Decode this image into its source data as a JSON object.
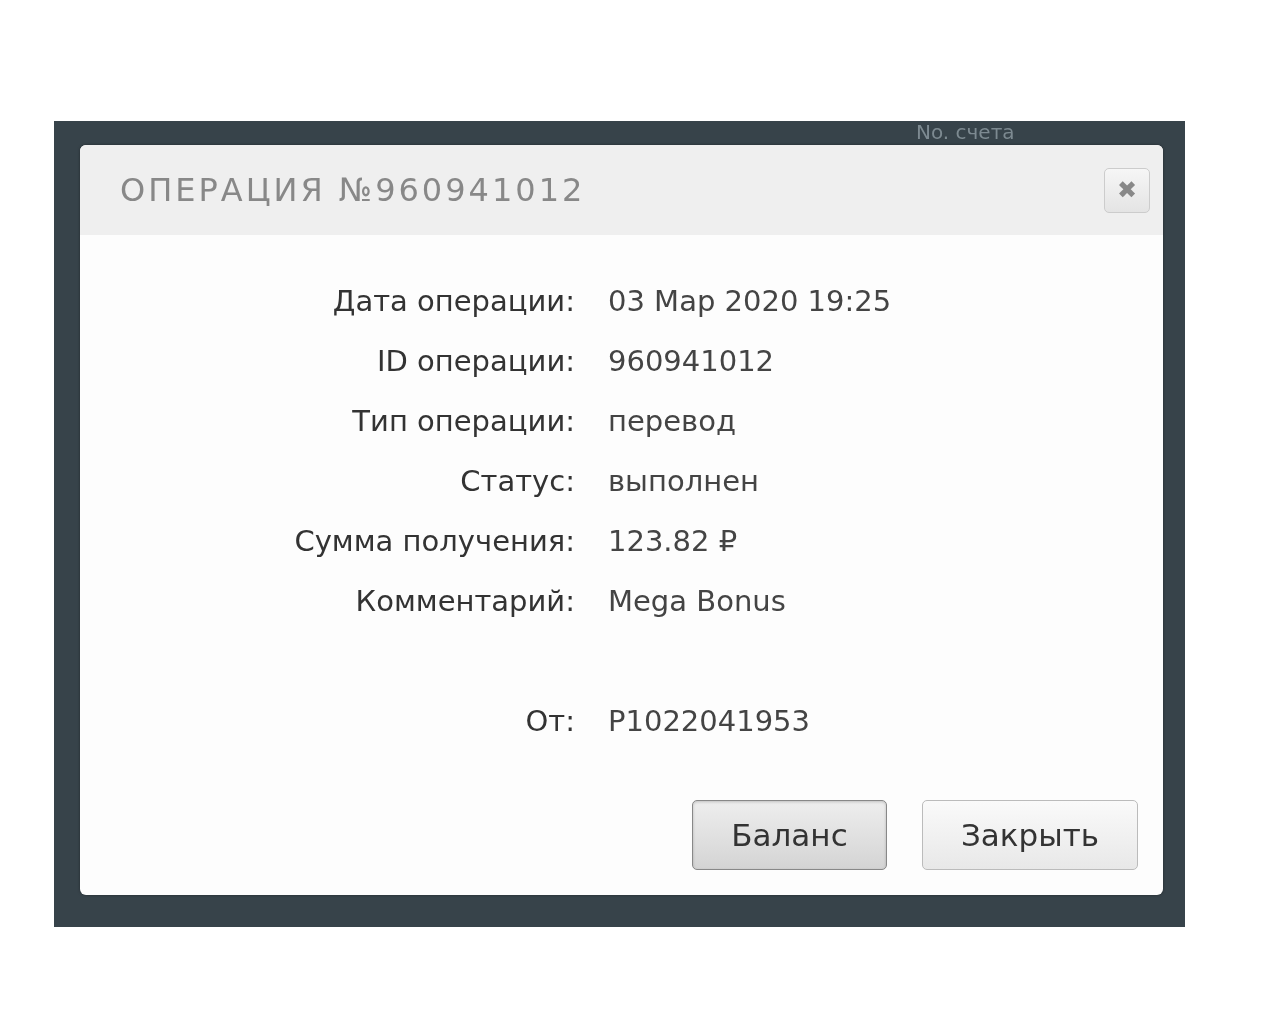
{
  "background": {
    "label": "No. счета"
  },
  "modal": {
    "title": "ОПЕРАЦИЯ №960941012",
    "close": "✖",
    "fields": [
      {
        "label": "Дата операции:",
        "value": "03 Мар 2020 19:25"
      },
      {
        "label": "ID операции:",
        "value": "960941012"
      },
      {
        "label": "Тип операции:",
        "value": "перевод"
      },
      {
        "label": "Статус:",
        "value": "выполнен"
      },
      {
        "label": "Сумма получения:",
        "value": "123.82 ₽"
      },
      {
        "label": "Комментарий:",
        "value": "Mega Bonus"
      }
    ],
    "sender": {
      "label": "От:",
      "value": "P1022041953"
    },
    "buttons": [
      {
        "label": "Баланс",
        "pressed": true
      },
      {
        "label": "Закрыть",
        "pressed": false
      }
    ]
  }
}
